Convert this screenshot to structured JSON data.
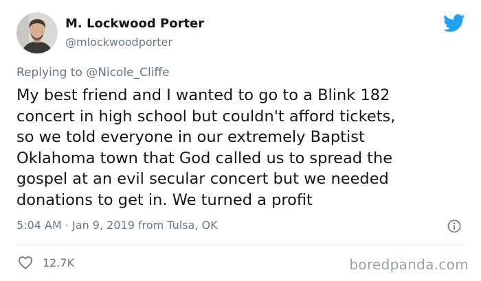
{
  "author": {
    "display_name": "M. Lockwood Porter",
    "handle": "@mlockwoodporter"
  },
  "reply": {
    "prefix": "Replying to",
    "mention": "@Nicole_Cliffe"
  },
  "tweet": {
    "lines": [
      "My best friend and I wanted to go to a Blink 182",
      "concert in high school but couldn't afford tickets,",
      "so we told everyone in our extremely Baptist",
      "Oklahoma town that God called us to spread the",
      "gospel at an evil secular concert but we needed",
      "donations to get in. We turned a profit"
    ]
  },
  "meta": {
    "time": "5:04 AM",
    "separator": "·",
    "date": "Jan 9, 2019",
    "location": "from Tulsa, OK"
  },
  "stats": {
    "likes": "12.7K"
  },
  "watermark": "boredpanda.com",
  "icons": {
    "bird": "twitter-bird-icon",
    "info": "info-icon",
    "like": "heart-icon"
  },
  "colors": {
    "brand": "#1da1f2",
    "text": "#14171a",
    "secondary": "#657786",
    "divider": "#e1e8ed",
    "watermark": "#9aa0a6"
  }
}
